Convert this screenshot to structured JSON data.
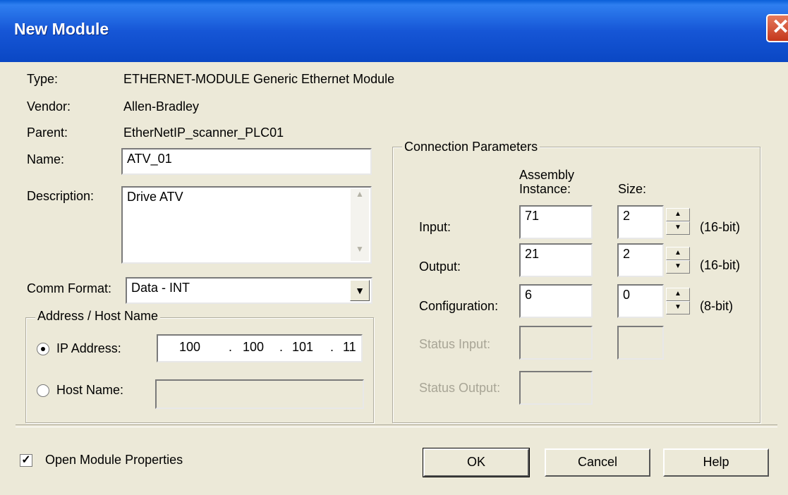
{
  "window": {
    "title": "New Module"
  },
  "info": {
    "type_label": "Type:",
    "type_value": "ETHERNET-MODULE Generic Ethernet Module",
    "vendor_label": "Vendor:",
    "vendor_value": "Allen-Bradley",
    "parent_label": "Parent:",
    "parent_value": "EtherNetIP_scanner_PLC01"
  },
  "name": {
    "label": "Name:",
    "value": "ATV_01"
  },
  "description": {
    "label": "Description:",
    "value": "Drive ATV"
  },
  "comm_format": {
    "label": "Comm Format:",
    "value": "Data - INT"
  },
  "address": {
    "group_title": "Address / Host Name",
    "ip_label": "IP Address:",
    "ip_octets": [
      "100",
      "100",
      "101",
      "11"
    ],
    "ip_selected": true,
    "host_label": "Host Name:",
    "host_value": ""
  },
  "connection": {
    "group_title": "Connection Parameters",
    "col_assembly_line1": "Assembly",
    "col_assembly_line2": "Instance:",
    "col_size": "Size:",
    "rows": [
      {
        "label": "Input:",
        "instance": "71",
        "size": "2",
        "unit": "(16-bit)",
        "enabled": true
      },
      {
        "label": "Output:",
        "instance": "21",
        "size": "2",
        "unit": "(16-bit)",
        "enabled": true
      },
      {
        "label": "Configuration:",
        "instance": "6",
        "size": "0",
        "unit": "(8-bit)",
        "enabled": true
      },
      {
        "label": "Status Input:",
        "instance": "",
        "size": "",
        "enabled": false
      },
      {
        "label": "Status Output:",
        "instance": "",
        "enabled": false
      }
    ]
  },
  "footer": {
    "open_props_label": "Open Module Properties",
    "open_props_checked": true,
    "ok_label": "OK",
    "cancel_label": "Cancel",
    "help_label": "Help"
  }
}
